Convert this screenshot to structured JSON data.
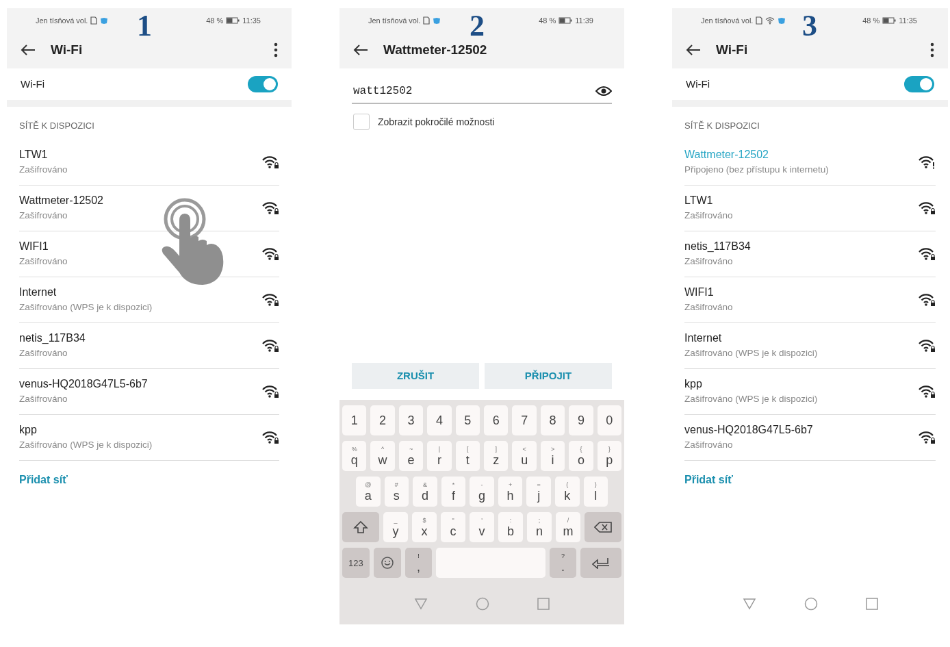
{
  "panels": [
    {
      "kind": "wifi-list",
      "step": "1",
      "status": {
        "carrier": "Jen tísňová vol.",
        "wifi": false,
        "battery": "48 %",
        "time": "11:35"
      },
      "title": "Wi-Fi",
      "wifi_label": "Wi-Fi",
      "wifi_on": true,
      "section": "SÍTĚ K DISPOZICI",
      "tap_gesture": true,
      "nav_bar": false,
      "networks": [
        {
          "name": "LTW1",
          "status": "Zašifrováno",
          "connected": false
        },
        {
          "name": "Wattmeter-12502",
          "status": "Zašifrováno",
          "connected": false
        },
        {
          "name": "WIFI1",
          "status": "Zašifrováno",
          "connected": false
        },
        {
          "name": "Internet",
          "status": "Zašifrováno (WPS je k dispozici)",
          "connected": false
        },
        {
          "name": "netis_117B34",
          "status": "Zašifrováno",
          "connected": false
        },
        {
          "name": "venus-HQ2018G47L5-6b7",
          "status": "Zašifrováno",
          "connected": false
        },
        {
          "name": "kpp",
          "status": "Zašifrováno (WPS je k dispozici)",
          "connected": false
        }
      ],
      "add_network": "Přidat síť"
    },
    {
      "kind": "password",
      "step": "2",
      "status": {
        "carrier": "Jen tísňová vol.",
        "wifi": false,
        "battery": "48 %",
        "time": "11:39"
      },
      "title": "Wattmeter-12502",
      "password": "watt12502",
      "advanced": {
        "label": "Zobrazit pokročilé možnosti",
        "checked": false
      },
      "buttons": [
        "ZRUŠIT",
        "PŘIPOJIT"
      ],
      "nav_bar": true,
      "keyboard": [
        [
          {
            "label": "1"
          },
          {
            "label": "2"
          },
          {
            "label": "3"
          },
          {
            "label": "4"
          },
          {
            "label": "5"
          },
          {
            "label": "6"
          },
          {
            "label": "7"
          },
          {
            "label": "8"
          },
          {
            "label": "9"
          },
          {
            "label": "0"
          }
        ],
        [
          {
            "label": "q",
            "alt": "%"
          },
          {
            "label": "w",
            "alt": "^"
          },
          {
            "label": "e",
            "alt": "~"
          },
          {
            "label": "r",
            "alt": "|"
          },
          {
            "label": "t",
            "alt": "["
          },
          {
            "label": "z",
            "alt": "]"
          },
          {
            "label": "u",
            "alt": "<"
          },
          {
            "label": "i",
            "alt": ">"
          },
          {
            "label": "o",
            "alt": "{"
          },
          {
            "label": "p",
            "alt": "}"
          }
        ],
        [
          {
            "label": "a",
            "alt": "@"
          },
          {
            "label": "s",
            "alt": "#"
          },
          {
            "label": "d",
            "alt": "&"
          },
          {
            "label": "f",
            "alt": "*"
          },
          {
            "label": "g",
            "alt": "-"
          },
          {
            "label": "h",
            "alt": "+"
          },
          {
            "label": "j",
            "alt": "="
          },
          {
            "label": "k",
            "alt": "("
          },
          {
            "label": "l",
            "alt": ")"
          }
        ],
        [
          {
            "kind": "shift"
          },
          {
            "label": "y",
            "alt": "_"
          },
          {
            "label": "x",
            "alt": "$"
          },
          {
            "label": "c",
            "alt": "\""
          },
          {
            "label": "v",
            "alt": "'"
          },
          {
            "label": "b",
            "alt": ":"
          },
          {
            "label": "n",
            "alt": ";"
          },
          {
            "label": "m",
            "alt": "/"
          },
          {
            "kind": "backspace"
          }
        ],
        [
          {
            "kind": "mode",
            "label": "123"
          },
          {
            "kind": "emoji"
          },
          {
            "label": ",",
            "alt": "!"
          },
          {
            "kind": "space"
          },
          {
            "label": ".",
            "alt": "?"
          },
          {
            "kind": "enter"
          }
        ]
      ]
    },
    {
      "kind": "wifi-list",
      "step": "3",
      "status": {
        "carrier": "Jen tísňová vol.",
        "wifi": true,
        "battery": "48 %",
        "time": "11:35"
      },
      "title": "Wi-Fi",
      "wifi_label": "Wi-Fi",
      "wifi_on": true,
      "section": "SÍTĚ K DISPOZICI",
      "tap_gesture": false,
      "nav_bar": true,
      "networks": [
        {
          "name": "Wattmeter-12502",
          "status": "Připojeno (bez přístupu k internetu)",
          "connected": true
        },
        {
          "name": "LTW1",
          "status": "Zašifrováno",
          "connected": false
        },
        {
          "name": "netis_117B34",
          "status": "Zašifrováno",
          "connected": false
        },
        {
          "name": "WIFI1",
          "status": "Zašifrováno",
          "connected": false
        },
        {
          "name": "Internet",
          "status": "Zašifrováno (WPS je k dispozici)",
          "connected": false
        },
        {
          "name": "kpp",
          "status": "Zašifrováno (WPS je k dispozici)",
          "connected": false
        },
        {
          "name": "venus-HQ2018G47L5-6b7",
          "status": "Zašifrováno",
          "connected": false
        }
      ],
      "add_network": "Přidat síť"
    }
  ]
}
